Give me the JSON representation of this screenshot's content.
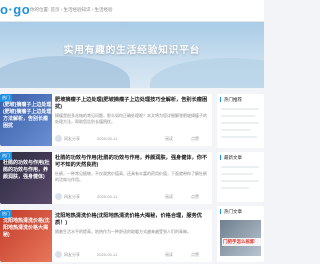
{
  "header": {
    "logo": "o·go",
    "breadcrumb": "你的位置: 首页 › 生活经验知识 › 生活经验"
  },
  "hero": {
    "title": "实用有趣的生活经验知识平台"
  },
  "articles": [
    {
      "tag": "热门",
      "thumb_text": "(肥坡)摘瘤子上边处理(肥坡)摘瘤子上边处理方法解析，告别长瘤困扰",
      "title": "肥坡摘瘤子上边处理(肥坡摘瘤子上边处理技巧全解析，告别长瘤困扰)",
      "excerpt": "摘瘤是很多苦恼的常见问题，那么如何正确处理呢？本文将为您详细解答肥坡摘瘤子的处理方法，帮助您告别长瘤困扰。",
      "author": "网友分享",
      "date": "2025-05-11",
      "views": "阅读",
      "likes": "点赞"
    },
    {
      "tag": "热门",
      "thumb_text": "杜鹃的功效与作用(杜鹃的功效与作用，养颜润肤，强身健体)",
      "title": "杜鹃的功效与作用(杜鹃的功效与作用，养颜润肤，强身健体，你不可不知的天然良药)",
      "excerpt": "杜鹃，一种常见植物，不仅观赏价值高，还具有丰富的药用价值，下面就带你了解杜鹃的功效与作用。",
      "author": "网友分享",
      "date": "2025-05-11",
      "views": "阅读",
      "likes": "点赞"
    },
    {
      "tag": "热门",
      "thumb_text": "沈阳地热清洗价格(沈阳地热清洗价格大揭秘)",
      "title": "沈阳地热清洗价格(沈阳地热清洗价格大揭秘，价格合理，服务优质！)",
      "excerpt": "随着生活水平的提高，地热作为一种舒适的取暖方式越来越受到人们的青睐。",
      "author": "网友分享",
      "date": "2025-05-11",
      "views": "阅读",
      "likes": "点赞"
    }
  ],
  "sidebar": {
    "widgets": [
      {
        "title": "热门推荐"
      },
      {
        "title": "最新文章"
      },
      {
        "title": "热门文章",
        "image_text": "门把手怎么拆卸"
      }
    ]
  },
  "colors": {
    "accent": "#1f8fe0",
    "background": "#f2f4f7"
  }
}
